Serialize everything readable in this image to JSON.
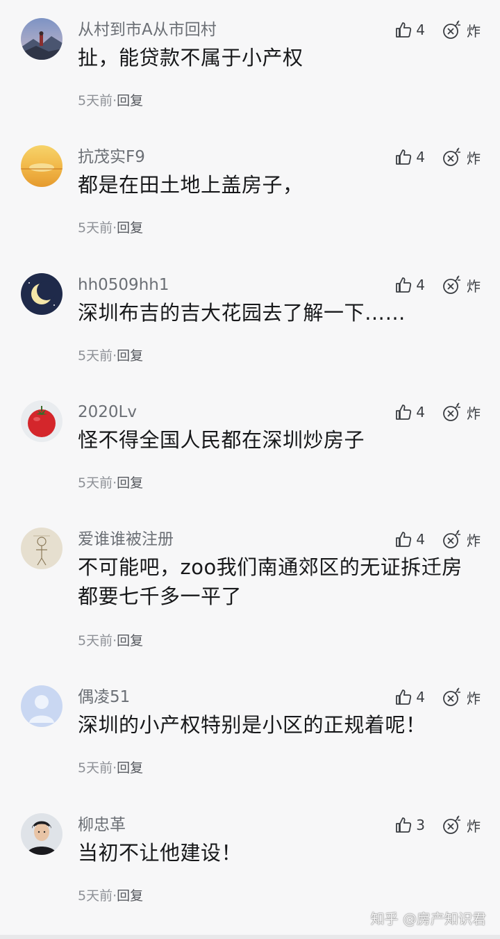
{
  "comments": [
    {
      "user": "从村到市A从市回村",
      "text": "扯，能贷款不属于小产权",
      "likes": "4",
      "bomb": "炸",
      "time": "5天前",
      "sep": "·",
      "reply": "回复",
      "avatar": "mountain-avatar"
    },
    {
      "user": "抗茂实F9",
      "text": "都是在田土地上盖房子，",
      "likes": "4",
      "bomb": "炸",
      "time": "5天前",
      "sep": "·",
      "reply": "回复",
      "avatar": "sunset-avatar"
    },
    {
      "user": "hh0509hh1",
      "text": "深圳布吉的吉大花园去了解一下……",
      "likes": "4",
      "bomb": "炸",
      "time": "5天前",
      "sep": "·",
      "reply": "回复",
      "avatar": "moon-avatar"
    },
    {
      "user": "2020Lv",
      "text": "怪不得全国人民都在深圳炒房子",
      "likes": "4",
      "bomb": "炸",
      "time": "5天前",
      "sep": "·",
      "reply": "回复",
      "avatar": "tomato-avatar"
    },
    {
      "user": "爱谁谁被注册",
      "text": "不可能吧，zoo我们南通郊区的无证拆迁房都要七千多一平了",
      "likes": "4",
      "bomb": "炸",
      "time": "5天前",
      "sep": "·",
      "reply": "回复",
      "avatar": "sketch-avatar"
    },
    {
      "user": "偶凌51",
      "text": "深圳的小产权特别是小区的正规着呢！",
      "likes": "4",
      "bomb": "炸",
      "time": "5天前",
      "sep": "·",
      "reply": "回复",
      "avatar": "default-user-avatar"
    },
    {
      "user": "柳忠革",
      "text": "当初不让他建设！",
      "likes": "3",
      "bomb": "炸",
      "time": "5天前",
      "sep": "·",
      "reply": "回复",
      "avatar": "portrait-avatar"
    }
  ],
  "watermark": "知乎 @房产知识君",
  "colors": {
    "background": "#f7f7f8",
    "username": "#6b6f75",
    "text": "#17181a",
    "meta": "#8d9096"
  }
}
